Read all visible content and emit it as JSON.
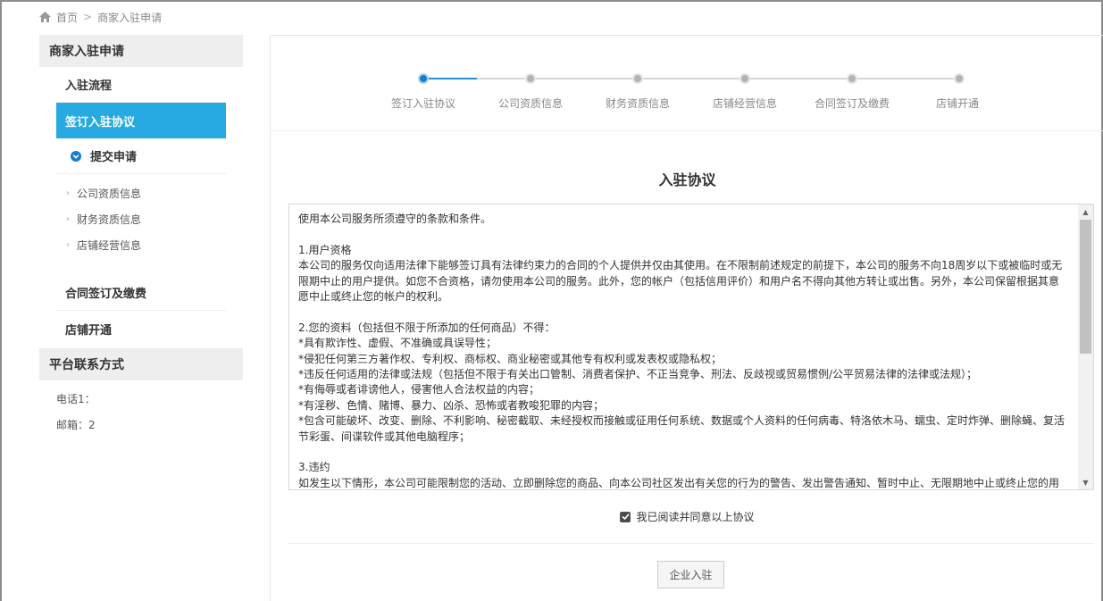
{
  "breadcrumb": {
    "home": "首页",
    "separator": ">",
    "current": "商家入驻申请"
  },
  "sidebar": {
    "header": "商家入驻申请",
    "items": [
      {
        "label": "入驻流程"
      },
      {
        "label": "签订入驻协议"
      },
      {
        "label": "提交申请"
      }
    ],
    "sub_items": [
      {
        "label": "公司资质信息"
      },
      {
        "label": "财务资质信息"
      },
      {
        "label": "店铺经营信息"
      }
    ],
    "items_after": [
      {
        "label": "合同签订及缴费"
      },
      {
        "label": "店铺开通"
      }
    ],
    "contact_header": "平台联系方式",
    "contact": {
      "phone": "电话1：",
      "email": "邮箱：2"
    }
  },
  "steps": [
    {
      "label": "签订入驻协议",
      "state": "current"
    },
    {
      "label": "公司资质信息",
      "state": "pending"
    },
    {
      "label": "财务资质信息",
      "state": "pending"
    },
    {
      "label": "店铺经营信息",
      "state": "pending"
    },
    {
      "label": "合同签订及缴费",
      "state": "pending"
    },
    {
      "label": "店铺开通",
      "state": "pending"
    }
  ],
  "agreement": {
    "title": "入驻协议",
    "lines": [
      "使用本公司服务所须遵守的条款和条件。",
      "",
      "1.用户资格",
      "本公司的服务仅向适用法律下能够签订具有法律约束力的合同的个人提供并仅由其使用。在不限制前述规定的前提下，本公司的服务不向18周岁以下或被临时或无",
      "限期中止的用户提供。如您不合资格，请勿使用本公司的服务。此外，您的帐户（包括信用评价）和用户名不得向其他方转让或出售。另外，本公司保留根据其意",
      "愿中止或终止您的帐户的权利。",
      "",
      "2.您的资料（包括但不限于所添加的任何商品）不得：",
      "*具有欺诈性、虚假、不准确或具误导性；",
      "*侵犯任何第三方著作权、专利权、商标权、商业秘密或其他专有权利或发表权或隐私权；",
      "*违反任何适用的法律或法规（包括但不限于有关出口管制、消费者保护、不正当竞争、刑法、反歧视或贸易惯例/公平贸易法律的法律或法规）；",
      "*有侮辱或者诽谤他人，侵害他人合法权益的内容；",
      "*有淫秽、色情、赌博、暴力、凶杀、恐怖或者教唆犯罪的内容；",
      "*包含可能破坏、改变、删除、不利影响、秘密截取、未经授权而接触或征用任何系统、数据或个人资料的任何病毒、特洛依木马、蠕虫、定时炸弹、删除蝇、复活",
      "节彩蛋、间谍软件或其他电脑程序；",
      "",
      "3.违约",
      "如发生以下情形，本公司可能限制您的活动、立即删除您的商品、向本公司社区发出有关您的行为的警告、发出警告通知、暂时中止、无限期地中止或终止您的用"
    ],
    "agree_label": "我已阅读并同意以上协议",
    "agree_checked": true,
    "submit_label": "企业入驻"
  },
  "colors": {
    "accent": "#27aae1",
    "step_active": "#1a7cc7"
  }
}
